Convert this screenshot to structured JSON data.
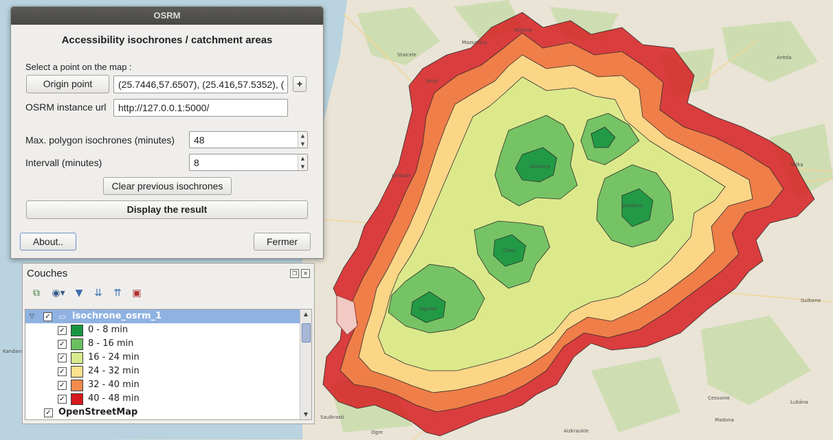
{
  "dialog": {
    "window_title": "OSRM",
    "heading": "Accessibility isochrones / catchment areas",
    "select_point_label": "Select a point on the map :",
    "origin_button": "Origin point",
    "origin_value": "(25.7446,57.6507), (25.416,57.5352), (",
    "add_button": "+",
    "instance_label": "OSRM instance url",
    "instance_value": "http://127.0.0.1:5000/",
    "max_label": "Max. polygon isochrones (minutes)",
    "max_value": "48",
    "interval_label": "Intervall (minutes)",
    "interval_value": "8",
    "clear_button": "Clear previous isochrones",
    "display_button": "Display the result",
    "about_button": "About..",
    "close_button": "Fermer"
  },
  "layers": {
    "title": "Couches",
    "group_name": "isochrone_osrm_1",
    "classes": [
      {
        "label": "0 - 8 min",
        "color": "#1a9641"
      },
      {
        "label": "8 - 16 min",
        "color": "#6abf60"
      },
      {
        "label": "16 - 24 min",
        "color": "#d7ec8c"
      },
      {
        "label": "24 - 32 min",
        "color": "#fde38f"
      },
      {
        "label": "32 - 40 min",
        "color": "#f28a4b"
      },
      {
        "label": "40 - 48 min",
        "color": "#d7191c"
      }
    ],
    "basemap": "OpenStreetMap"
  },
  "map": {
    "towns": [
      "Valmiera",
      "Smiltene",
      "Cēsis",
      "Sigulda",
      "Aizkraukle",
      "Rūjiena",
      "Mazsalaca",
      "Staicele",
      "Aloja",
      "Limbaži",
      "Antsla",
      "Valka",
      "Gulbene",
      "Cesvaine",
      "Madona",
      "Lubāna",
      "Ogre",
      "Kandava",
      "Saulkrasti"
    ]
  }
}
